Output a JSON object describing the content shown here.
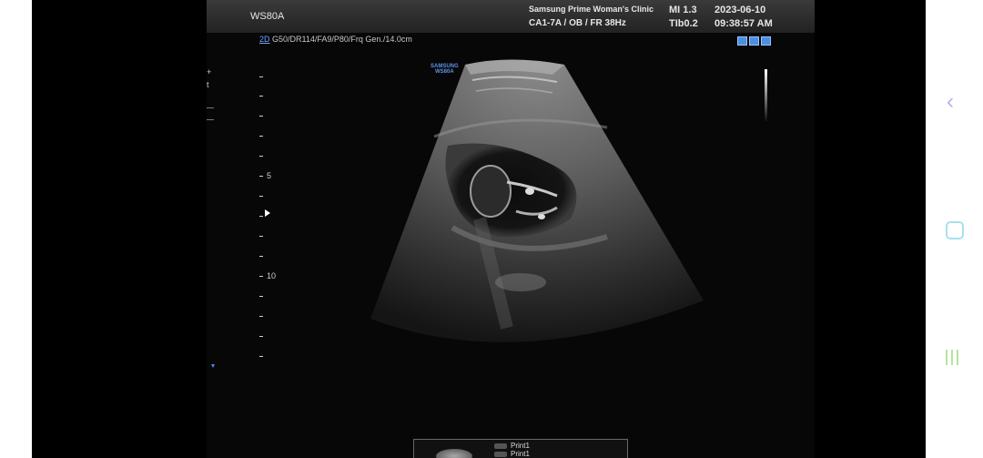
{
  "header": {
    "model": "WS80A",
    "clinic": "Samsung Prime Woman's Clinic",
    "probe_preset": "CA1-7A / OB / FR 38Hz",
    "mi": "MI  1.3",
    "tib": "TIb0.2",
    "date": "2023-06-10",
    "time": "09:38:57 AM"
  },
  "params": {
    "mode": "2D",
    "values": " G50/DR114/FA9/P80/Frq Gen./14.0cm"
  },
  "brand": {
    "line1": "SAMSUNG",
    "line2": "WS80A"
  },
  "depth_scale": {
    "labels": [
      "5",
      "10"
    ]
  },
  "left_marks": [
    "+",
    "t"
  ],
  "print_menu": {
    "items": [
      "Print1",
      "Print1"
    ]
  },
  "navbar": {
    "back_icon": "chevron-left-icon",
    "home_icon": "rounded-square-home-icon",
    "recents_icon": "three-bars-recents-icon"
  },
  "colors": {
    "mode_blue": "#6aa3ff",
    "nav_back": "#b3b0ef",
    "nav_home": "#a9dff0",
    "nav_recents": "#b7e3a0"
  }
}
